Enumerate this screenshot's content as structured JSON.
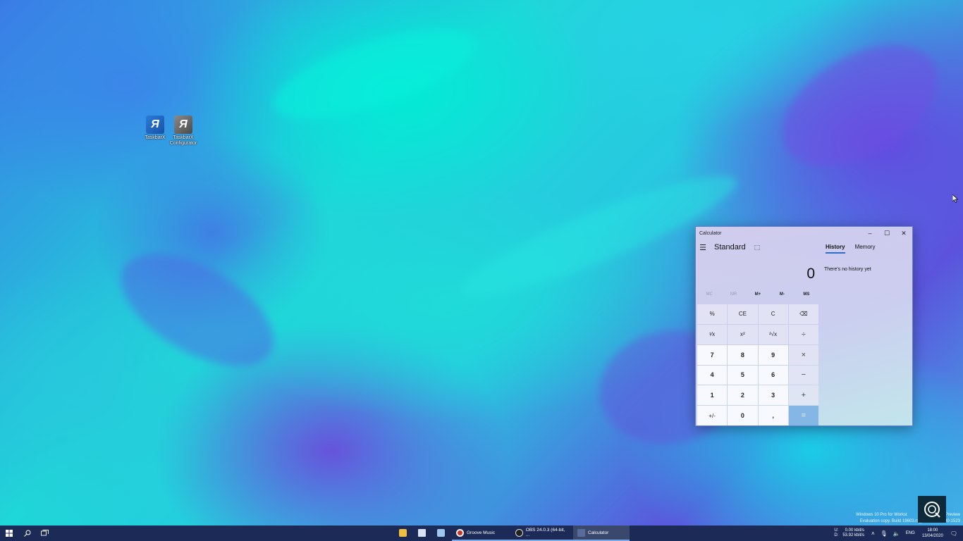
{
  "desktop": {
    "icons": [
      {
        "label": "TaskbarX",
        "icon": "taskbarx-icon"
      },
      {
        "label": "TaskbarX Configurator",
        "icon": "taskbarx-configurator-icon"
      }
    ]
  },
  "calculator": {
    "title": "Calculator",
    "mode": "Standard",
    "display": "0",
    "memory_buttons": [
      "MC",
      "MR",
      "M+",
      "M-",
      "MS"
    ],
    "keys": [
      "%",
      "CE",
      "C",
      "⌫",
      "¹⁄x",
      "x²",
      "²√x",
      "÷",
      "7",
      "8",
      "9",
      "×",
      "4",
      "5",
      "6",
      "−",
      "1",
      "2",
      "3",
      "+",
      "+/-",
      "0",
      ",",
      "="
    ],
    "tabs": {
      "history": "History",
      "memory": "Memory"
    },
    "history_empty": "There's no history yet"
  },
  "watermark": {
    "line1_left": "Windows 10 Pro for Workst",
    "line1_right": "Preview",
    "line2_left": "Evaluation copy. Build 19603.rs_p",
    "line2_right": "30-1523"
  },
  "taskbar": {
    "apps": [
      {
        "label": "",
        "icon": "store-icon"
      },
      {
        "label": "",
        "icon": "notepad-icon"
      },
      {
        "label": "",
        "icon": "feather-icon"
      },
      {
        "label": "Groove Music",
        "icon": "groove-music-icon"
      },
      {
        "label": "OBS 24.0.3 (64-bit, ...",
        "icon": "obs-icon"
      },
      {
        "label": "Calculator",
        "icon": "calculator-icon"
      }
    ],
    "network": {
      "up_label": "U:",
      "down_label": "D:",
      "up": "0.00 kbit/s",
      "down": "53.92 kbit/s"
    },
    "language": "ENG",
    "time": "18:00",
    "date": "13/04/2020"
  }
}
